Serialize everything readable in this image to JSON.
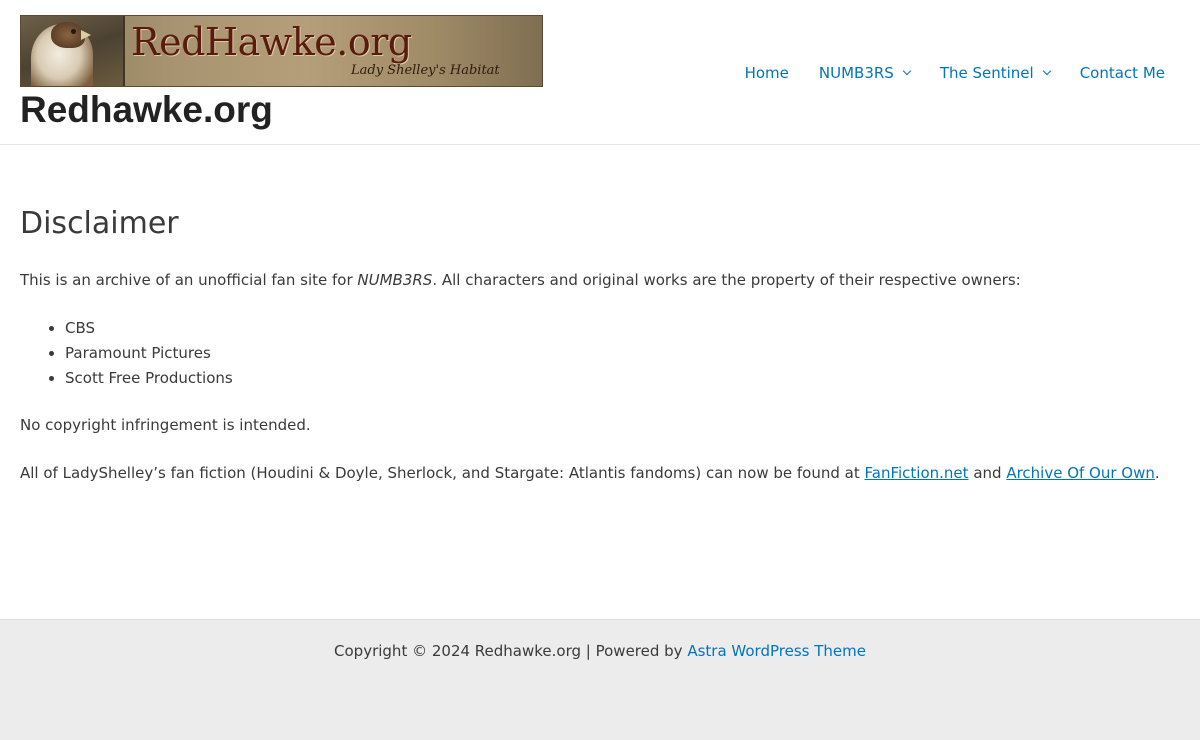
{
  "header": {
    "banner_title": "RedHawke.org",
    "banner_subtitle": "Lady Shelley's Habitat",
    "site_title": "Redhawke.org"
  },
  "nav": {
    "items": [
      {
        "label": "Home",
        "has_dropdown": false
      },
      {
        "label": "NUMB3RS",
        "has_dropdown": true
      },
      {
        "label": "The Sentinel",
        "has_dropdown": true
      },
      {
        "label": "Contact Me",
        "has_dropdown": false
      }
    ]
  },
  "main": {
    "title": "Disclaimer",
    "intro_before": "This is an archive of an unofficial fan site for ",
    "intro_italic": "NUMB3RS",
    "intro_after": ". All characters and original works are the property of their respective owners:",
    "owners": [
      "CBS",
      "Paramount Pictures",
      "Scott Free Productions"
    ],
    "no_infringement": "No copyright infringement is intended.",
    "fanfic_before": "All of LadyShelley’s fan fiction (Houdini & Doyle, Sherlock, and Stargate: Atlantis fandoms) can now be found at ",
    "fanfic_link1": "FanFiction.net",
    "fanfic_middle": " and ",
    "fanfic_link2": "Archive Of Our Own",
    "fanfic_after": "."
  },
  "footer": {
    "text": "Copyright © 2024 Redhawke.org | Powered by ",
    "link": "Astra WordPress Theme"
  },
  "colors": {
    "link": "#0274be",
    "text": "#3a3a3a",
    "footer_bg": "#ececec"
  }
}
